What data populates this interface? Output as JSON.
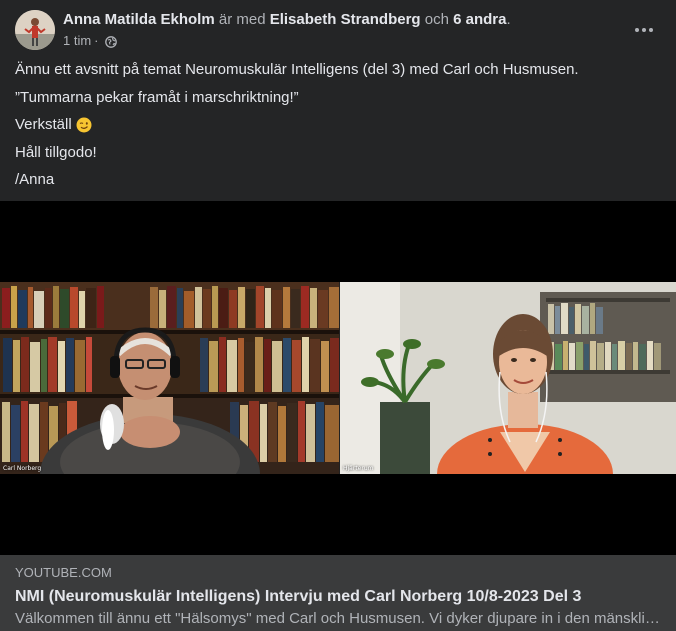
{
  "header": {
    "author": "Anna Matilda Ekholm",
    "with_text": "är med",
    "tagged": "Elisabeth Strandberg",
    "and_text": "och",
    "others": "6 andra",
    "period": ".",
    "time": "1 tim",
    "separator": "·",
    "privacy_icon": "globe-icon",
    "more_icon": "more-options-icon"
  },
  "post": {
    "lines": [
      "Ännu ett avsnitt på temat Neuromuskulär Intelligens (del 3) med Carl och Husmusen.",
      "”Tummarna pekar framåt i marschriktning!”",
      "Verkställ",
      "Håll tillgodo!",
      "/Anna"
    ],
    "emoji_icon": "winking-face-emoji"
  },
  "video": {
    "left_name": "Carl Norberg",
    "right_name": "Hjärterum"
  },
  "link": {
    "domain": "YOUTUBE.COM",
    "title": "NMI (Neuromuskulär Intelligens) Intervju med Carl Norberg 10/8-2023 Del 3",
    "description": "Välkommen till ännu ett \"Hälsomys\" med Carl och Husmusen. Vi dyker djupare in i den mänskliga kroppens fascinerande värld…"
  },
  "colors": {
    "card_bg": "#242526",
    "link_bg": "#3a3b3c",
    "text_primary": "#e4e6eb",
    "text_secondary": "#b0b3b8"
  }
}
